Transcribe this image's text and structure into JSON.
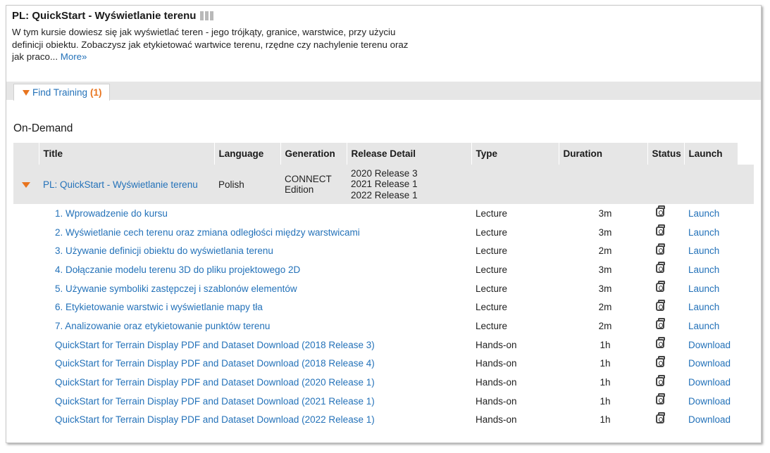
{
  "course": {
    "title": "PL: QuickStart - Wyświetlanie terenu",
    "description": "W tym kursie dowiesz się jak wyświetlać teren - jego trójkąty, granice, warstwice, przy użyciu definicji obiektu. Zobaczysz jak etykietować wartwice terenu, rzędne czy nachylenie terenu oraz jak praco...",
    "more_label": "More»"
  },
  "tabs": {
    "find_training_label": "Find Training",
    "find_training_count": "(1)"
  },
  "section": {
    "title": "On-Demand"
  },
  "columns": {
    "title": "Title",
    "language": "Language",
    "generation": "Generation",
    "release_detail": "Release Detail",
    "type": "Type",
    "duration": "Duration",
    "status": "Status",
    "launch": "Launch"
  },
  "course_row": {
    "title": "PL: QuickStart - Wyświetlanie terenu",
    "language": "Polish",
    "generation_line1": "CONNECT",
    "generation_line2": "Edition",
    "releases": [
      "2020 Release 3",
      "2021 Release 1",
      "2022 Release 1"
    ]
  },
  "items": [
    {
      "title": "1. Wprowadzenie do kursu",
      "type": "Lecture",
      "duration": "3m",
      "action": "Launch"
    },
    {
      "title": "2. Wyświetlanie cech terenu oraz zmiana odległości między warstwicami",
      "type": "Lecture",
      "duration": "3m",
      "action": "Launch"
    },
    {
      "title": "3. Używanie definicji obiektu do wyświetlania terenu",
      "type": "Lecture",
      "duration": "2m",
      "action": "Launch"
    },
    {
      "title": "4. Dołączanie modelu terenu 3D do pliku projektowego 2D",
      "type": "Lecture",
      "duration": "3m",
      "action": "Launch"
    },
    {
      "title": "5. Używanie symboliki zastępczej i szablonów elementów",
      "type": "Lecture",
      "duration": "3m",
      "action": "Launch"
    },
    {
      "title": "6. Etykietowanie warstwic i wyświetlanie mapy tła",
      "type": "Lecture",
      "duration": "2m",
      "action": "Launch"
    },
    {
      "title": "7. Analizowanie oraz etykietowanie punktów terenu",
      "type": "Lecture",
      "duration": "2m",
      "action": "Launch"
    },
    {
      "title": "QuickStart for Terrain Display PDF and Dataset Download (2018 Release 3)",
      "type": "Hands-on",
      "duration": "1h",
      "action": "Download"
    },
    {
      "title": "QuickStart for Terrain Display PDF and Dataset Download (2018 Release 4)",
      "type": "Hands-on",
      "duration": "1h",
      "action": "Download"
    },
    {
      "title": "QuickStart for Terrain Display PDF and Dataset Download (2020 Release 1)",
      "type": "Hands-on",
      "duration": "1h",
      "action": "Download"
    },
    {
      "title": "QuickStart for Terrain Display PDF and Dataset Download (2021 Release 1)",
      "type": "Hands-on",
      "duration": "1h",
      "action": "Download"
    },
    {
      "title": "QuickStart for Terrain Display PDF and Dataset Download (2022 Release 1)",
      "type": "Hands-on",
      "duration": "1h",
      "action": "Download"
    }
  ],
  "icons": {
    "rating": "rating-bars-icon",
    "tab_toggle": "triangle-down-icon",
    "course_toggle": "triangle-down-icon",
    "status": "camera-status-icon"
  },
  "colors": {
    "link": "#2472b9",
    "accent": "#e8741e",
    "header_bg": "#e6e6e6"
  }
}
